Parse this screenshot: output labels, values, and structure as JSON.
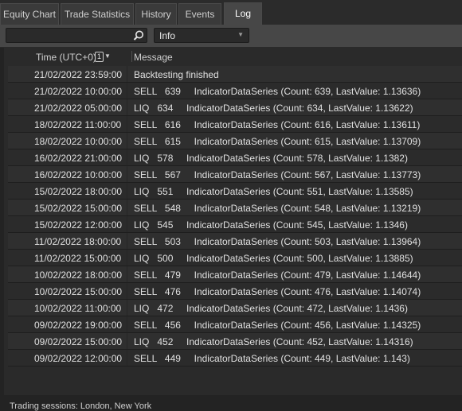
{
  "tabs": [
    {
      "label": "Equity Chart"
    },
    {
      "label": "Trade Statistics"
    },
    {
      "label": "History"
    },
    {
      "label": "Events"
    },
    {
      "label": "Log",
      "active": true
    }
  ],
  "toolbar": {
    "search_value": "",
    "search_icon": "search-icon",
    "filter_selected": "Info"
  },
  "table": {
    "columns": {
      "time": "Time (UTC+0)",
      "message": "Message"
    },
    "sort_badge": "1",
    "rows": [
      {
        "time": "21/02/2022 23:59:00",
        "message": "Backtesting finished"
      },
      {
        "time": "21/02/2022 10:00:00",
        "message": "SELL   639     IndicatorDataSeries (Count: 639, LastValue: 1.13636)"
      },
      {
        "time": "21/02/2022 05:00:00",
        "message": "LIQ   634     IndicatorDataSeries (Count: 634, LastValue: 1.13622)"
      },
      {
        "time": "18/02/2022 11:00:00",
        "message": "SELL   616     IndicatorDataSeries (Count: 616, LastValue: 1.13611)"
      },
      {
        "time": "18/02/2022 10:00:00",
        "message": "SELL   615     IndicatorDataSeries (Count: 615, LastValue: 1.13709)"
      },
      {
        "time": "16/02/2022 21:00:00",
        "message": "LIQ   578     IndicatorDataSeries (Count: 578, LastValue: 1.1382)"
      },
      {
        "time": "16/02/2022 10:00:00",
        "message": "SELL   567     IndicatorDataSeries (Count: 567, LastValue: 1.13773)"
      },
      {
        "time": "15/02/2022 18:00:00",
        "message": "LIQ   551     IndicatorDataSeries (Count: 551, LastValue: 1.13585)"
      },
      {
        "time": "15/02/2022 15:00:00",
        "message": "SELL   548     IndicatorDataSeries (Count: 548, LastValue: 1.13219)"
      },
      {
        "time": "15/02/2022 12:00:00",
        "message": "LIQ   545     IndicatorDataSeries (Count: 545, LastValue: 1.1346)"
      },
      {
        "time": "11/02/2022 18:00:00",
        "message": "SELL   503     IndicatorDataSeries (Count: 503, LastValue: 1.13964)"
      },
      {
        "time": "11/02/2022 15:00:00",
        "message": "LIQ   500     IndicatorDataSeries (Count: 500, LastValue: 1.13885)"
      },
      {
        "time": "10/02/2022 18:00:00",
        "message": "SELL   479     IndicatorDataSeries (Count: 479, LastValue: 1.14644)"
      },
      {
        "time": "10/02/2022 15:00:00",
        "message": "SELL   476     IndicatorDataSeries (Count: 476, LastValue: 1.14074)"
      },
      {
        "time": "10/02/2022 11:00:00",
        "message": "LIQ   472     IndicatorDataSeries (Count: 472, LastValue: 1.1436)"
      },
      {
        "time": "09/02/2022 19:00:00",
        "message": "SELL   456     IndicatorDataSeries (Count: 456, LastValue: 1.14325)"
      },
      {
        "time": "09/02/2022 15:00:00",
        "message": "LIQ   452     IndicatorDataSeries (Count: 452, LastValue: 1.14316)"
      },
      {
        "time": "09/02/2022 12:00:00",
        "message": "SELL   449     IndicatorDataSeries (Count: 449, LastValue: 1.143)"
      }
    ]
  },
  "status_bar": {
    "text": "Trading sessions: London, New York"
  }
}
